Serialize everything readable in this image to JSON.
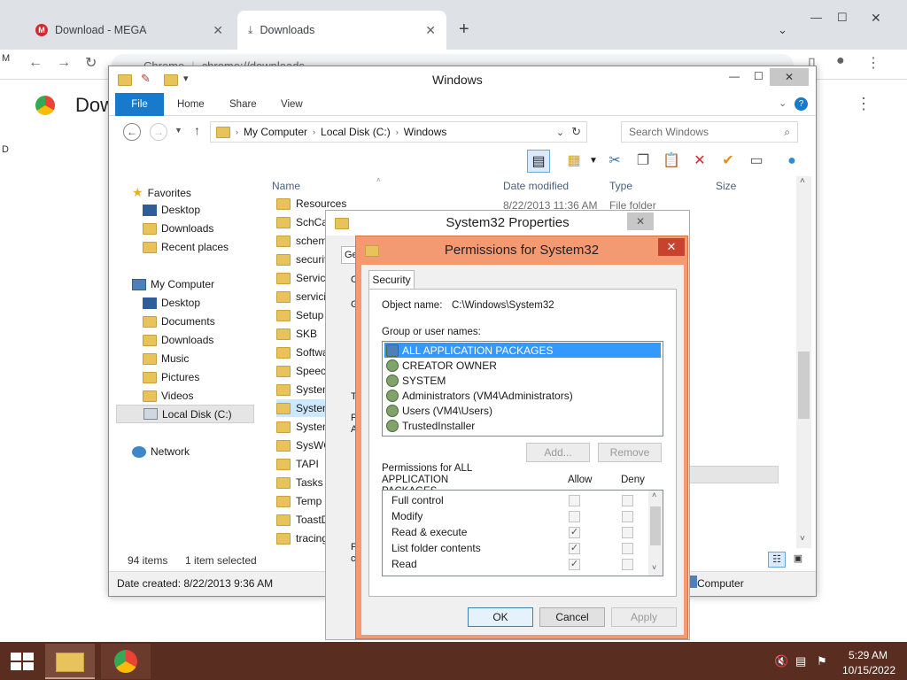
{
  "browser": {
    "tabs": [
      {
        "title": "Download - MEGA",
        "active": false
      },
      {
        "title": "Downloads",
        "active": true
      }
    ],
    "new_tab_symbol": "+",
    "address_origin": "Chrome",
    "address_url": "chrome://downloads",
    "page_heading": "Dow",
    "side_letters": [
      "M",
      "D"
    ]
  },
  "explorer": {
    "title": "Windows",
    "ribbon_tabs": [
      "File",
      "Home",
      "Share",
      "View"
    ],
    "breadcrumb": [
      "My Computer",
      "Local Disk (C:)",
      "Windows"
    ],
    "search_placeholder": "Search Windows",
    "nav": {
      "favorites_header": "Favorites",
      "favorites": [
        "Desktop",
        "Downloads",
        "Recent places"
      ],
      "computer_header": "My Computer",
      "computer_items": [
        "Desktop",
        "Documents",
        "Downloads",
        "Music",
        "Pictures",
        "Videos",
        "Local Disk (C:)"
      ],
      "network": "Network"
    },
    "columns": {
      "name": "Name",
      "date_modified": "Date modified",
      "type": "Type",
      "size": "Size"
    },
    "first_row": {
      "date": "8/22/2013 11:36 AM",
      "type": "File folder"
    },
    "files": [
      "Resources",
      "SchCac",
      "schema",
      "security",
      "Servicel",
      "servicin",
      "Setup",
      "SKB",
      "Softwar",
      "Speech",
      "System",
      "System",
      "System",
      "SysWO",
      "TAPI",
      "Tasks",
      "Temp",
      "ToastDa",
      "tracing"
    ],
    "status_count": "94 items",
    "status_selected": "1 item selected",
    "date_created": "Date created: 8/22/2013 9:36 AM",
    "location": "Computer"
  },
  "props_dialog": {
    "title": "System32 Properties",
    "partial_tab": "Ge",
    "partial_letters": [
      "O",
      "G",
      "T",
      "F",
      "A",
      "F",
      "c"
    ]
  },
  "perm_dialog": {
    "title": "Permissions for System32",
    "tab": "Security",
    "object_label": "Object name:",
    "object_value": "C:\\Windows\\System32",
    "group_label": "Group or user names:",
    "users": [
      "ALL APPLICATION PACKAGES",
      "CREATOR OWNER",
      "SYSTEM",
      "Administrators (VM4\\Administrators)",
      "Users (VM4\\Users)",
      "TrustedInstaller"
    ],
    "add_button": "Add...",
    "remove_button": "Remove",
    "perms_for": "Permissions for ALL APPLICATION PACKAGES",
    "allow_header": "Allow",
    "deny_header": "Deny",
    "permissions": [
      {
        "name": "Full control",
        "allow": false,
        "deny": false
      },
      {
        "name": "Modify",
        "allow": false,
        "deny": false
      },
      {
        "name": "Read & execute",
        "allow": true,
        "deny": false
      },
      {
        "name": "List folder contents",
        "allow": true,
        "deny": false
      },
      {
        "name": "Read",
        "allow": true,
        "deny": false
      }
    ],
    "ok": "OK",
    "cancel": "Cancel",
    "apply": "Apply"
  },
  "taskbar": {
    "time": "5:29 AM",
    "date": "10/15/2022"
  },
  "colors": {
    "accent_blue": "#1979ca",
    "dialog_frame": "#f49a73",
    "taskbar": "#5a2d21",
    "selection": "#3399ff",
    "close_red": "#c7432f"
  },
  "icons": [
    "mega-icon",
    "download-icon",
    "chrome-icon",
    "folder-icon",
    "star-icon",
    "network-icon",
    "windows-start-icon",
    "explorer-icon",
    "mute-icon"
  ]
}
